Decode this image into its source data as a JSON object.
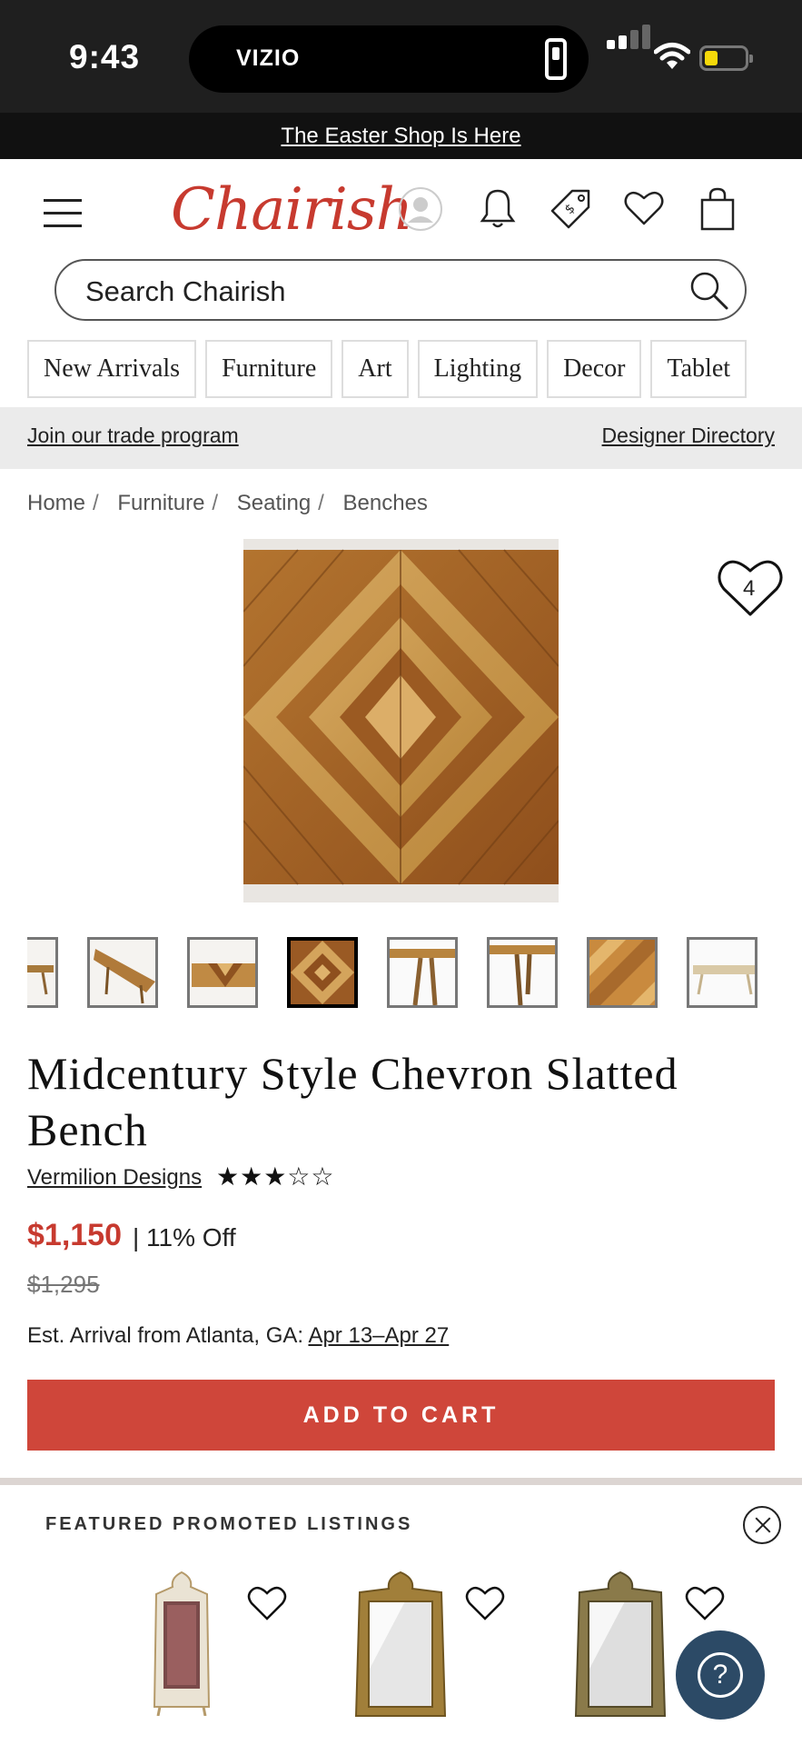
{
  "status_bar": {
    "time": "9:43",
    "island_label": "VIZIO",
    "icons": [
      "remote-icon",
      "signal-icon",
      "wifi-icon",
      "battery-icon"
    ]
  },
  "promo_banner": {
    "text": "The Easter Shop Is Here"
  },
  "header": {
    "logo": "Chairish",
    "icons": [
      "menu-icon",
      "account-icon",
      "bell-icon",
      "price-tag-icon",
      "heart-icon",
      "shopping-bag-icon"
    ]
  },
  "search": {
    "placeholder": "Search Chairish"
  },
  "categories": [
    "New Arrivals",
    "Furniture",
    "Art",
    "Lighting",
    "Decor",
    "Tablet"
  ],
  "trade_bar": {
    "left_link": "Join our trade program",
    "right_link": "Designer Directory"
  },
  "breadcrumb": [
    "Home",
    "Furniture",
    "Seating",
    "Benches"
  ],
  "product": {
    "favorite_count": "4",
    "title": "Midcentury Style Chevron Slatted Bench",
    "seller": "Vermilion Designs",
    "rating": 3,
    "rating_max": 5,
    "stars_text": "★★★☆☆",
    "price": "$1,150",
    "discount": "| 11% Off",
    "original_price": "$1,295",
    "arrival_label": "Est. Arrival from Atlanta, GA:",
    "arrival_dates": "Apr 13–Apr 27",
    "add_to_cart": "ADD TO CART",
    "thumbnail_count": 8,
    "active_thumbnail": 4
  },
  "featured": {
    "heading": "FEATURED PROMOTED LISTINGS",
    "listings": [
      "vitrine cabinet",
      "gilt mirror",
      "gilt mirror"
    ]
  },
  "colors": {
    "brand_red": "#c73a2f",
    "cart_red": "#cf463a",
    "help_button": "#2c4a66"
  }
}
